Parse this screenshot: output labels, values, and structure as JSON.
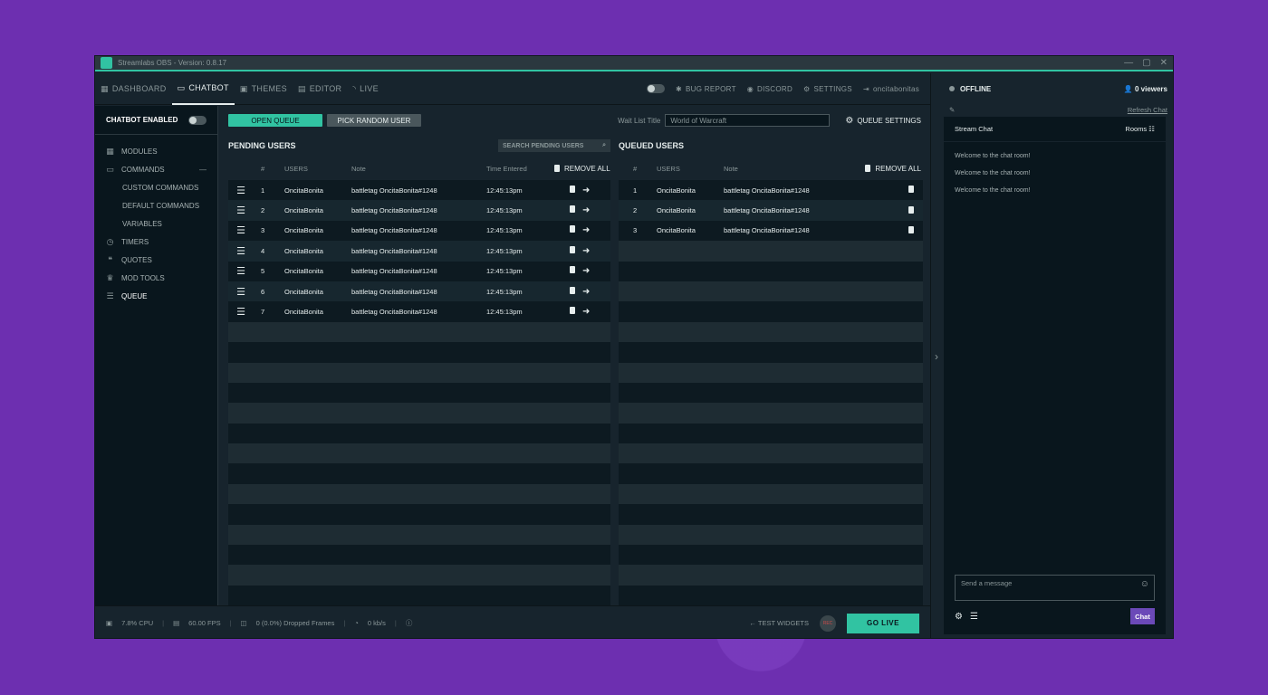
{
  "window": {
    "title": "Streamlabs OBS - Version: 0.8.17"
  },
  "nav": {
    "dashboard": "DASHBOARD",
    "chatbot": "CHATBOT",
    "themes": "THEMES",
    "editor": "EDITOR",
    "live": "LIVE",
    "bug_report": "BUG REPORT",
    "discord": "DISCORD",
    "settings": "SETTINGS",
    "user": "oncitabonitas"
  },
  "sidebar": {
    "chatbot_enabled": "CHATBOT ENABLED",
    "modules": "MODULES",
    "commands": "COMMANDS",
    "custom_commands": "CUSTOM COMMANDS",
    "default_commands": "DEFAULT COMMANDS",
    "variables": "VARIABLES",
    "timers": "TIMERS",
    "quotes": "QUOTES",
    "mod_tools": "MOD TOOLS",
    "queue": "QUEUE"
  },
  "toolbar": {
    "open_queue": "OPEN QUEUE",
    "pick_random": "PICK RANDOM USER",
    "wait_list_label": "Wait List Title",
    "wait_list_value": "World of Warcraft",
    "queue_settings": "QUEUE SETTINGS"
  },
  "pending": {
    "title": "PENDING USERS",
    "search_placeholder": "Search Pending Users",
    "headers": {
      "num": "#",
      "users": "USERS",
      "note": "Note",
      "time": "Time Entered",
      "remove_all": "REMOVE ALL"
    },
    "rows": [
      {
        "num": "1",
        "user": "OncitaBonita",
        "note": "battletag OncitaBonita#1248",
        "time": "12:45:13pm"
      },
      {
        "num": "2",
        "user": "OncitaBonita",
        "note": "battletag OncitaBonita#1248",
        "time": "12:45:13pm"
      },
      {
        "num": "3",
        "user": "OncitaBonita",
        "note": "battletag OncitaBonita#1248",
        "time": "12:45:13pm"
      },
      {
        "num": "4",
        "user": "OncitaBonita",
        "note": "battletag OncitaBonita#1248",
        "time": "12:45:13pm"
      },
      {
        "num": "5",
        "user": "OncitaBonita",
        "note": "battletag OncitaBonita#1248",
        "time": "12:45:13pm"
      },
      {
        "num": "6",
        "user": "OncitaBonita",
        "note": "battletag OncitaBonita#1248",
        "time": "12:45:13pm"
      },
      {
        "num": "7",
        "user": "OncitaBonita",
        "note": "battletag OncitaBonita#1248",
        "time": "12:45:13pm"
      }
    ]
  },
  "queued": {
    "title": "QUEUED USERS",
    "headers": {
      "num": "#",
      "users": "USERS",
      "note": "Note",
      "remove_all": "REMOVE ALL"
    },
    "rows": [
      {
        "num": "1",
        "user": "OncitaBonita",
        "note": "battletag OncitaBonita#1248"
      },
      {
        "num": "2",
        "user": "OncitaBonita",
        "note": "battletag OncitaBonita#1248"
      },
      {
        "num": "3",
        "user": "OncitaBonita",
        "note": "battletag OncitaBonita#1248"
      }
    ]
  },
  "footer": {
    "cpu": "7.8% CPU",
    "fps": "60.00 FPS",
    "dropped": "0 (0.0%) Dropped Frames",
    "bandwidth": "0 kb/s",
    "test_widgets": "TEST WIDGETS",
    "rec": "REC",
    "go_live": "GO LIVE"
  },
  "right": {
    "status": "OFFLINE",
    "viewers": "0 viewers",
    "refresh": "Refresh Chat",
    "chat_title": "Stream Chat",
    "rooms": "Rooms",
    "messages": [
      "Welcome to the chat room!",
      "Welcome to the chat room!",
      "Welcome to the chat room!"
    ],
    "input_placeholder": "Send a message",
    "chat_button": "Chat"
  },
  "colors": {
    "accent": "#31c3a2",
    "chat_button": "#6b49b8",
    "background": "#17242d"
  }
}
